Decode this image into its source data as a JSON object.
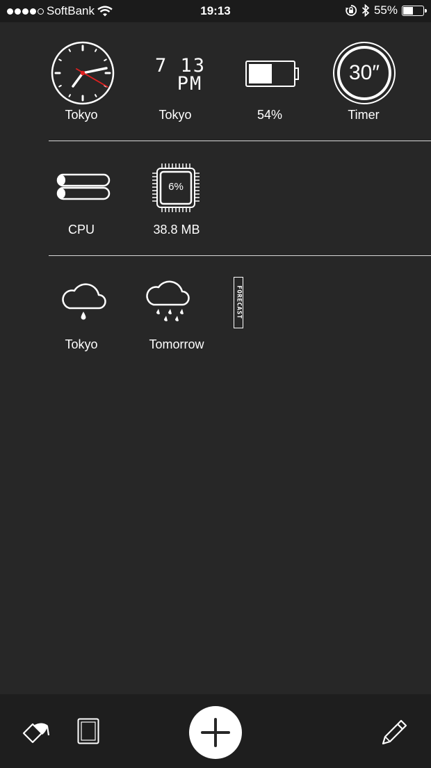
{
  "status_bar": {
    "carrier": "SoftBank",
    "time": "19:13",
    "battery_percent": "55%",
    "battery_level": 0.55
  },
  "widgets": {
    "row1": {
      "analog_clock_label": "Tokyo",
      "digital_clock": {
        "line1": "7 13",
        "line2": "PM",
        "label": "Tokyo"
      },
      "battery": {
        "label": "54%",
        "level": 0.54
      },
      "timer": {
        "value": "30″",
        "label": "Timer"
      }
    },
    "row2": {
      "cpu_label": "CPU",
      "memory": {
        "value": "6%",
        "label": "38.8 MB"
      }
    },
    "row3": {
      "weather_now_label": "Tokyo",
      "forecast": {
        "tag": "FORECAST",
        "label": "Tomorrow"
      }
    }
  },
  "icons": {
    "wifi": "wifi-icon",
    "orientation_lock": "orientation-lock-icon",
    "bluetooth": "bluetooth-icon",
    "eraser": "eraser-icon",
    "page": "page-icon",
    "add": "plus-icon",
    "edit": "pencil-icon"
  },
  "colors": {
    "background": "#272727",
    "toolbar": "#1e1e1e",
    "accent_red": "#e02020",
    "foreground": "#ffffff"
  }
}
